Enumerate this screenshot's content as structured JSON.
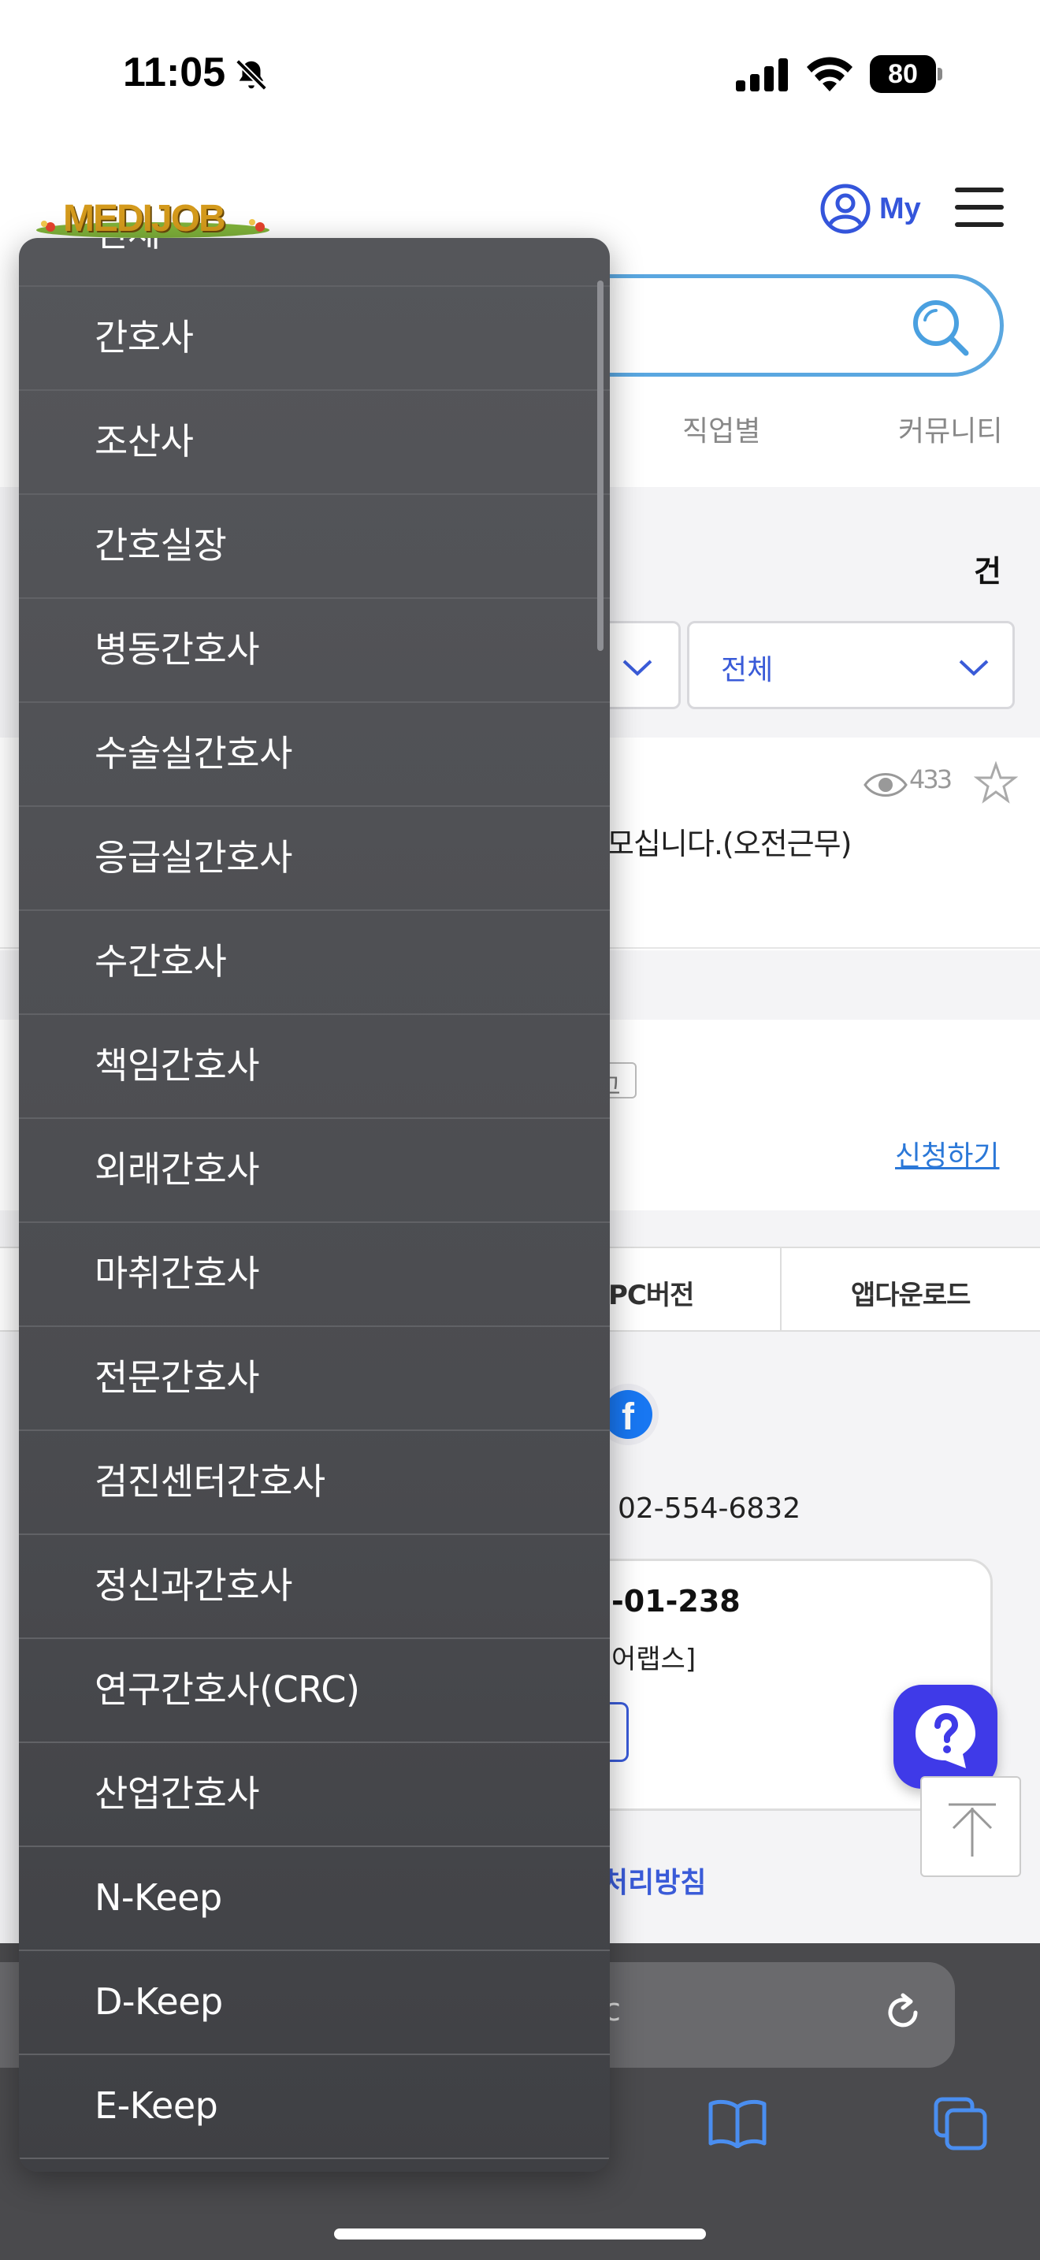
{
  "status_bar": {
    "time": "11:05",
    "battery": "80",
    "icons": [
      "bell-slash-icon",
      "signal-icon",
      "wifi-icon",
      "battery-icon"
    ]
  },
  "header": {
    "logo_text": "MEDIJOB",
    "my_label": "My"
  },
  "nav_tabs": {
    "job": "직업별",
    "community": "커뮤니티"
  },
  "filters": {
    "count_unit": "건",
    "select_b_value": "전체"
  },
  "post": {
    "views": "433",
    "title_fragment": "모십니다.(오전근무)"
  },
  "ad": {
    "tag_fragment": "고",
    "apply_link": "신청하기"
  },
  "footer": {
    "pc_version": "PC버전",
    "app_download": "앱다운로드",
    "phone": "02-554-6832",
    "reg_number_fragment": "-01-238",
    "company_fragment": "어랩스]",
    "privacy_fragment": "처리방침"
  },
  "browser": {
    "url_fragment": "c"
  },
  "dropdown": {
    "items": [
      "전체",
      "간호사",
      "조산사",
      "간호실장",
      "병동간호사",
      "수술실간호사",
      "응급실간호사",
      "수간호사",
      "책임간호사",
      "외래간호사",
      "마취간호사",
      "전문간호사",
      "검진센터간호사",
      "정신과간호사",
      "연구간호사(CRC)",
      "산업간호사",
      "N-Keep",
      "D-Keep",
      "E-Keep"
    ]
  },
  "colors": {
    "accent_blue": "#3a5bd8",
    "search_border": "#5aa7e0",
    "help_button": "#3f3ae8",
    "dropdown_bg": "#4b4c50"
  }
}
